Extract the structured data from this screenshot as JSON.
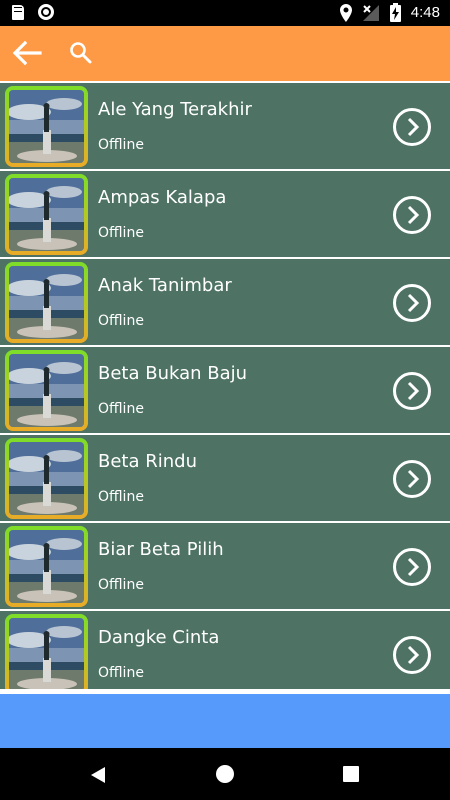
{
  "status_bar": {
    "time": "4:48",
    "icons": [
      "sd-card-icon",
      "circle-icon",
      "location-icon",
      "no-signal-icon",
      "battery-charging-icon"
    ]
  },
  "toolbar": {
    "background": "#fe9a45",
    "back_icon": "arrow-left-icon",
    "search_icon": "search-icon"
  },
  "list": {
    "row_background": "#4e7364",
    "items": [
      {
        "title": "Ale Yang Terakhir",
        "status": "Offline"
      },
      {
        "title": "Ampas Kalapa",
        "status": "Offline"
      },
      {
        "title": "Anak Tanimbar",
        "status": "Offline"
      },
      {
        "title": "Beta Bukan Baju",
        "status": "Offline"
      },
      {
        "title": "Beta Rindu",
        "status": "Offline"
      },
      {
        "title": "Biar Beta Pilih",
        "status": "Offline"
      },
      {
        "title": "Dangke Cinta",
        "status": "Offline"
      }
    ]
  },
  "banner": {
    "background": "#569afc"
  },
  "nav_bar": {
    "icons": [
      "nav-back-icon",
      "nav-home-icon",
      "nav-recents-icon"
    ]
  }
}
